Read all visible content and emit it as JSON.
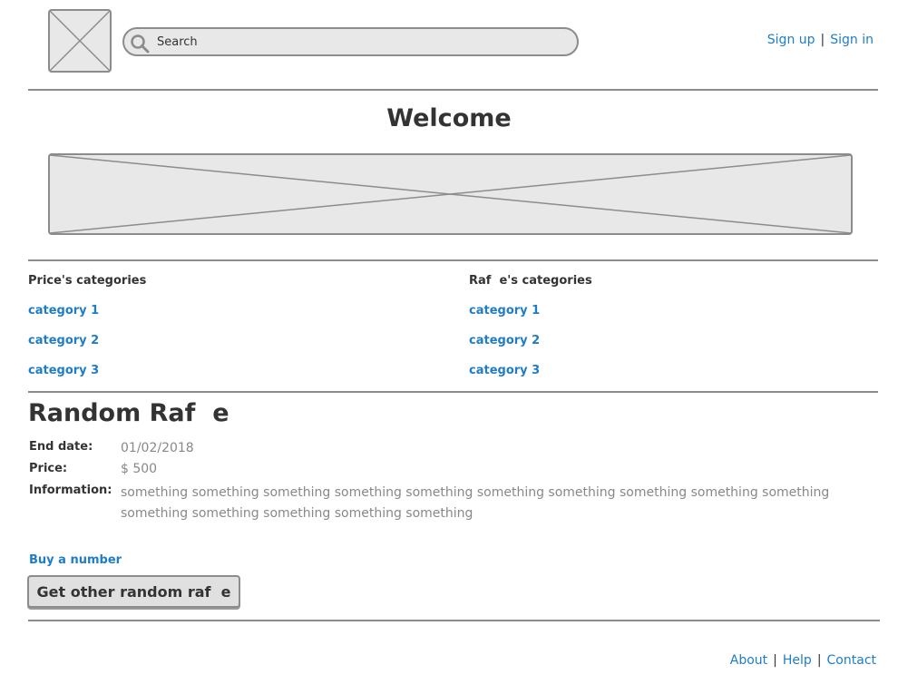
{
  "header": {
    "logo_icon": "image-placeholder-icon",
    "search": {
      "placeholder": "Search",
      "value": "",
      "icon": "search-icon"
    },
    "sign_up": "Sign up",
    "sign_in": "Sign in",
    "separator": "|"
  },
  "welcome": {
    "title": "Welcome",
    "banner_icon": "image-placeholder-icon"
  },
  "categories": {
    "price": {
      "title": "Price's categories",
      "items": [
        "category 1",
        "category 2",
        "category 3"
      ]
    },
    "raffle": {
      "title": "Raf  e's categories",
      "items": [
        "category 1",
        "category 2",
        "category 3"
      ]
    }
  },
  "random_raffle": {
    "title": "Random Raf  e",
    "end_date_label": "End date:",
    "end_date": "01/02/2018",
    "price_label": "Price:",
    "price": "$ 500",
    "information_label": "Information:",
    "information": "something something something something something something something something something something something something something something something",
    "buy_link": "Buy a number",
    "button_label": "Get other random raf  e"
  },
  "footer": {
    "about": "About",
    "help": "Help",
    "contact": "Contact",
    "separator": "|"
  },
  "colors": {
    "link": "#1f7dc6",
    "text": "#333333",
    "muted_text": "#888888",
    "placeholder_fill": "#e8e8e8",
    "rule": "#8c8c8c"
  }
}
